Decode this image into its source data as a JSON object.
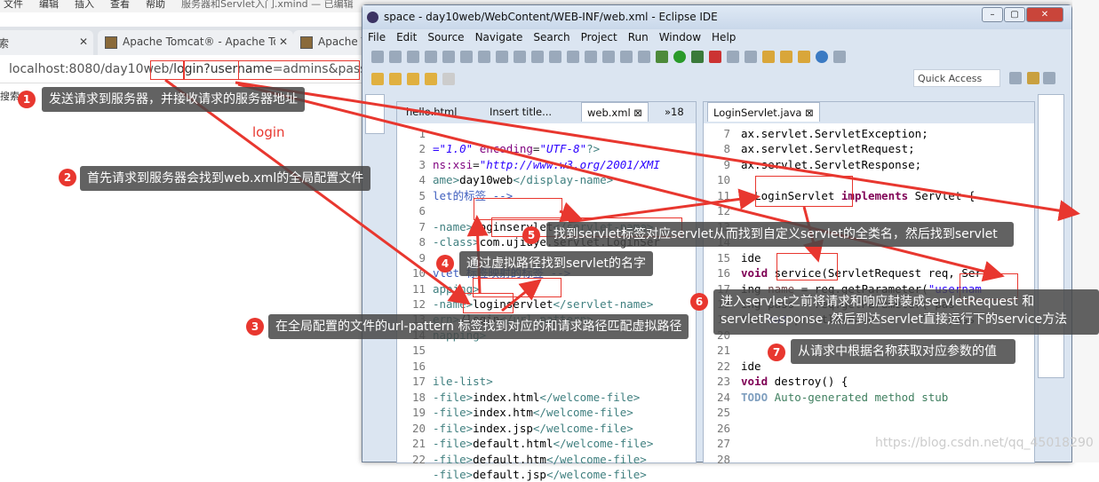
{
  "app_menu": {
    "items": [
      "文件",
      "编辑",
      "插入",
      "查看",
      "帮助"
    ],
    "doc_title": "服务器和Servlet入门.xmind — 已编辑"
  },
  "browser": {
    "tabs": [
      {
        "label": "索"
      },
      {
        "label": "Apache Tomcat® - Apache To"
      },
      {
        "label": "Apache T"
      }
    ],
    "url_base": "localhost:8080/day10web/",
    "url_path": "login",
    "url_q": "?",
    "url_param": "username",
    "url_rest": "=admins&password=",
    "search_label": "搜索"
  },
  "eclipse": {
    "title": "space - day10web/WebContent/WEB-INF/web.xml - Eclipse IDE",
    "menu": [
      "File",
      "Edit",
      "Source",
      "Navigate",
      "Search",
      "Project",
      "Run",
      "Window",
      "Help"
    ],
    "quick_access": "Quick Access",
    "left_tabs": [
      {
        "label": "hello.html"
      },
      {
        "label": "Insert title..."
      },
      {
        "label": "web.xml"
      },
      {
        "label": "»18"
      }
    ],
    "right_tabs": [
      {
        "label": "LoginServlet.java"
      }
    ],
    "xml_lines": [
      "1",
      "2",
      "3",
      "4",
      "5",
      "6",
      "7",
      "8",
      "9",
      "10",
      "11",
      "12",
      "13",
      "14",
      "15",
      "16",
      "17",
      "18",
      "19",
      "20",
      "21",
      "22"
    ],
    "java_lines": [
      "7",
      "8",
      "9",
      "10",
      "11",
      "12",
      "13",
      "14",
      "15",
      "16",
      "17",
      "18",
      "19",
      "20",
      "21",
      "22",
      "23",
      "24",
      "25",
      "26",
      "27",
      "28"
    ]
  },
  "annotations": {
    "login_label": "login",
    "c1": "发送请求到服务器，并接收请求的服务器地址",
    "c2": "首先请求到服务器会找到web.xml的全局配置文件",
    "c3": "在全局配置的文件的url-pattern 标签找到对应的和请求路径匹配虚拟路径",
    "c4": "通过虚拟路径找到servlet的名字",
    "c5": "找到servlet标签对应servlet从而找到自定义servlet的全类名，然后找到servlet",
    "c6a": "进入servlet之前将请求和响应封装成servletRequest 和",
    "c6b": "servletResponse ,然后到达servlet直接运行下的service方法",
    "c7": "从请求中根据名称获取对应参数的值",
    "n": [
      "1",
      "2",
      "3",
      "4",
      "5",
      "6",
      "7"
    ]
  },
  "watermark": "https://blog.csdn.net/qq_45018290",
  "colors": {
    "annotation_red": "#e8372f",
    "callout_bg": "#464646"
  }
}
